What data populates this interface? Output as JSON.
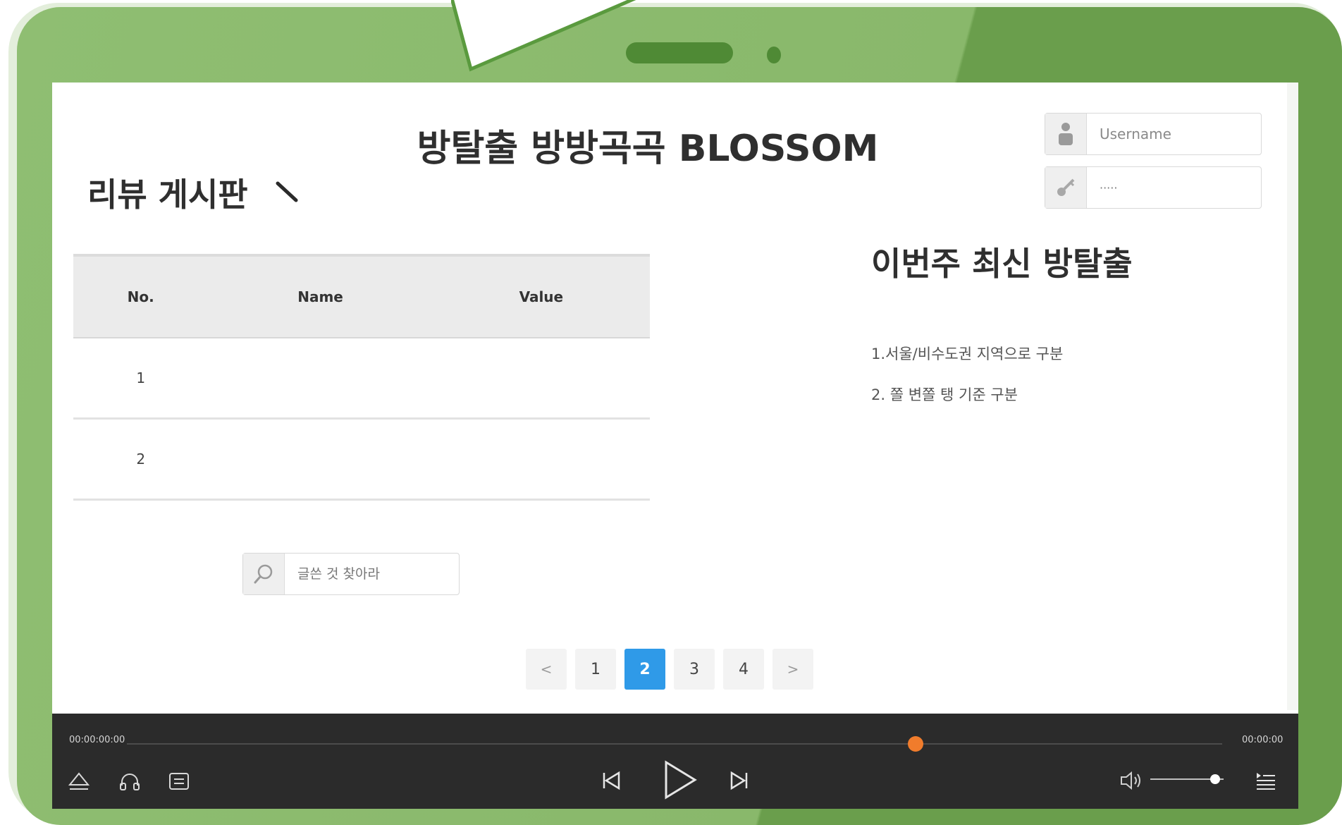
{
  "header": {
    "title": "방탈출 방방곡곡 BLOSSOM"
  },
  "login": {
    "username_placeholder": "Username",
    "password_value": "·····",
    "user_icon": "user-icon",
    "key_icon": "key-icon"
  },
  "board": {
    "title": "리뷰 게시판",
    "icon": "pencil-icon",
    "columns": [
      "No.",
      "Name",
      "Value"
    ],
    "rows": [
      {
        "no": "1",
        "name": "",
        "value": ""
      },
      {
        "no": "2",
        "name": "",
        "value": ""
      }
    ]
  },
  "side": {
    "title": "이번주 최신 방탈출",
    "items": [
      "1.서울/비수도권 지역으로 구분",
      "2. 쫄 변쫄 탱 기준 구분"
    ]
  },
  "search": {
    "placeholder": "글쓴 것 찾아라",
    "icon": "search-icon"
  },
  "pagination": {
    "prev": "<",
    "next": ">",
    "pages": [
      "1",
      "2",
      "3",
      "4"
    ],
    "current": "2",
    "active_color": "#2f9ae8"
  },
  "player": {
    "time_current": "00:00:00:00",
    "time_total": "00:00:00",
    "progress": 0.72,
    "volume": 0.88,
    "accent_color": "#f07c2c",
    "left_icons": [
      "eject-icon",
      "headphones-icon",
      "subtitles-icon"
    ],
    "center_icons": [
      "skip-previous-icon",
      "play-icon",
      "skip-next-icon"
    ],
    "right_icons": [
      "volume-icon",
      "playlist-icon"
    ]
  },
  "colors": {
    "bezel": "#89b86b",
    "bezel_dark": "#6a9e4c"
  }
}
